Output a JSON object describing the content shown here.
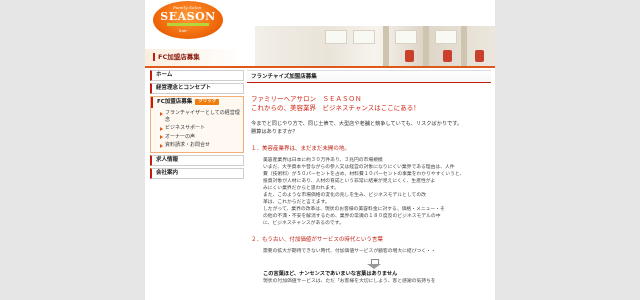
{
  "logo": {
    "top": "Family Salon",
    "main": "SEASON",
    "sub": "hair"
  },
  "page_title": "FC加盟店募集",
  "sidebar": {
    "items": [
      {
        "label": "ホーム"
      },
      {
        "label": "経営理念とコンセプト"
      }
    ],
    "group": {
      "label": "FC加盟店募集",
      "badge": "クリック",
      "sub_items": [
        {
          "label": "フランチャイザーとしての経営理念"
        },
        {
          "label": "ビジネスサポート"
        },
        {
          "label": "オーナーの声"
        },
        {
          "label": "資料請求・お問合せ"
        }
      ]
    },
    "bottom_items": [
      {
        "label": "求人情報"
      },
      {
        "label": "会社案内"
      }
    ]
  },
  "main": {
    "heading": "フランチャイズ加盟店募集",
    "catch_line1": "ファミリーヘアサロン　ＳＥＡＳＯＮ",
    "catch_line2": "これからの、美容業界　ビジネスチャンスはここにある！",
    "intro_line1": "今までと同じやり方で、同じ土俵で、大型店や老舗と競争していても、リスクばかりです。",
    "intro_line2": "勝算はありますか？",
    "section1_title": "１．美容産業界は、まだまだ未開の地。",
    "section1_lines": [
      "美容産業界は日本に約３０万件あり、３兆円の市場規模",
      "いまだ、大手資本や昔ながらの参入又は経営の対象になりにくい業界である理由は、人件",
      "費（技術料）が５０パーセントを占め、材料費１０パーセントの事業をわかりやすくいうと、",
      "投資対象が人材にあり、人材の育成という非常に結果が見えにくく、生産性がよ",
      "みにくい業界だからと思われます。",
      "また、このような市場価格の変化の兆しを生み、ビジネスモデルとしての改",
      "革は、これからだと言えます。",
      "したがって、業界の改革は、現状のお客様の美容料金に対する、価格・メニュー・そ",
      "の他の不満・不安を解消するため、業界の常識の１８０度反のビジネスモデルの中",
      "に、ビジネスチャンスがあるのです。"
    ],
    "section2_title": "２．もう古い、付加価値がサービスの時代という言葉",
    "section2_line": "需要の拡大が期待できない時代、付加価値サービスが顧客の増大に結びつく・・",
    "bold_line": "この言葉ほど、ナンセンスであいまいな言葉はありません",
    "cut_line": "現状の付加価値サービスは、ただ「お客様を大切にしよう、客と感謝の気持ちを"
  }
}
